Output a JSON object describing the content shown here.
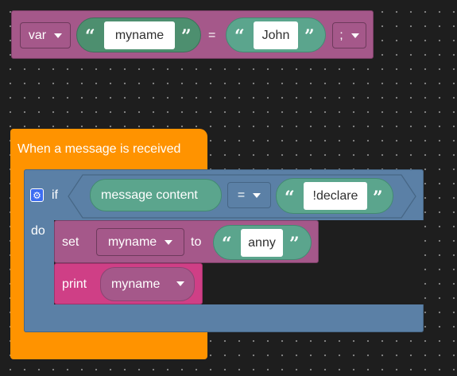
{
  "var_block": {
    "keyword": "var",
    "name_value": "myname",
    "equals": "=",
    "value": "John",
    "terminator": ";"
  },
  "event_block": {
    "label": "When a message is received",
    "if_block": {
      "if_label": "if",
      "do_label": "do",
      "condition": {
        "left": "message content",
        "operator": "=",
        "right": "!declare"
      },
      "set_block": {
        "set_label": "set",
        "variable": "myname",
        "to_label": "to",
        "value": "anny"
      },
      "print_block": {
        "print_label": "print",
        "variable": "myname"
      }
    }
  },
  "quote_open": "“",
  "quote_close": "”",
  "icons": {
    "dropdown": "caret-down-icon",
    "settings": "gear-icon"
  },
  "colors": {
    "background": "#1e1e1e",
    "variable_block": "#a5588a",
    "event_block": "#ff9300",
    "if_block": "#5b80a6",
    "print_block": "#cf3f86",
    "text_pill": "#5ba58d",
    "gear": "#3d6df2"
  }
}
